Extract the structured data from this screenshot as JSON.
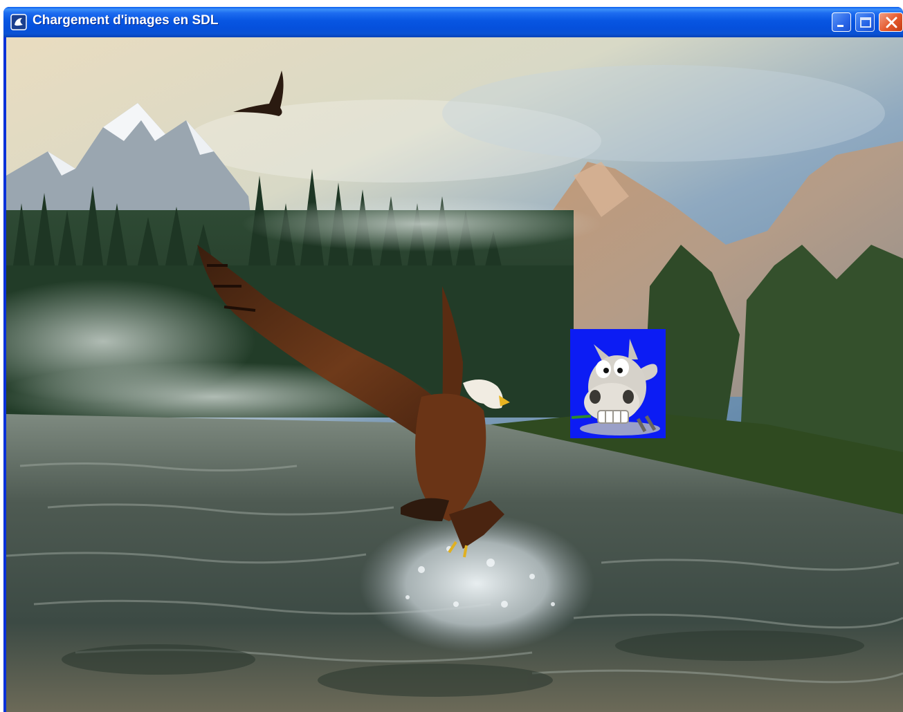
{
  "window": {
    "title": "Chargement d'images en SDL",
    "app_icon": "sdl-window-icon",
    "controls": {
      "minimize_icon": "minimize-icon",
      "maximize_icon": "maximize-icon",
      "close_icon": "close-icon"
    }
  },
  "scene": {
    "background_image": "eagle-over-lake-landscape",
    "sprite_image": "cartoon-donkey-sprite"
  },
  "colors": {
    "titlebar_blue": "#0a52d4",
    "close_red": "#e4582b",
    "sprite_background_blue": "#0c1cf4"
  }
}
